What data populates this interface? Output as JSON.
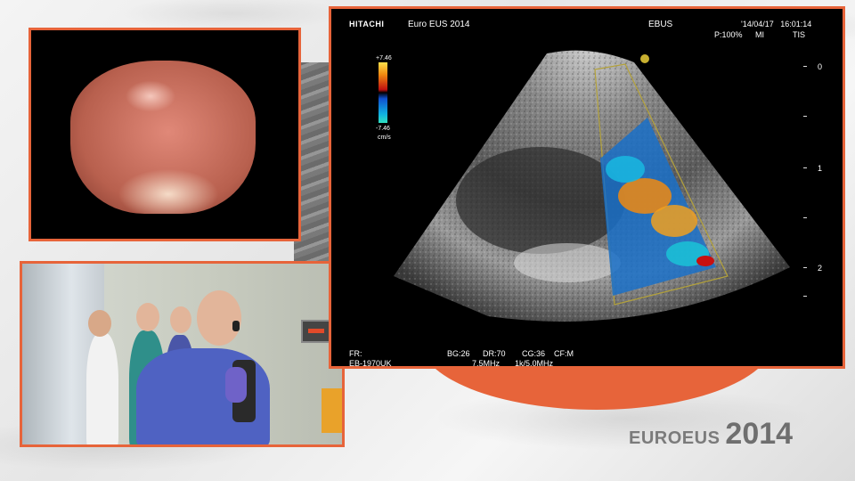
{
  "ultrasound": {
    "brand": "HITACHI",
    "title": "Euro EUS 2014",
    "mode": "EBUS",
    "date_time": "'14/04/17   16:01:14",
    "power": "P:100%",
    "mi": "MI",
    "tis": "TIS",
    "scale_top": "+7.46",
    "scale_bottom": "-7.46",
    "scale_unit": "cm/s",
    "fr_label": "FR:",
    "probe": "EB-1970UK",
    "bg": "BG:26",
    "dr": "DR:70",
    "cg": "CG:36",
    "cf": "CF:M",
    "freq": "7.5MHz",
    "prf": "1k/5.0MHz",
    "depth_marks": [
      "0",
      "1",
      "2"
    ]
  },
  "logo": {
    "word": "EUROEUS",
    "year": "2014"
  },
  "colors": {
    "frame_accent": "#e7643a",
    "logo_text": "#7b7b7b"
  }
}
